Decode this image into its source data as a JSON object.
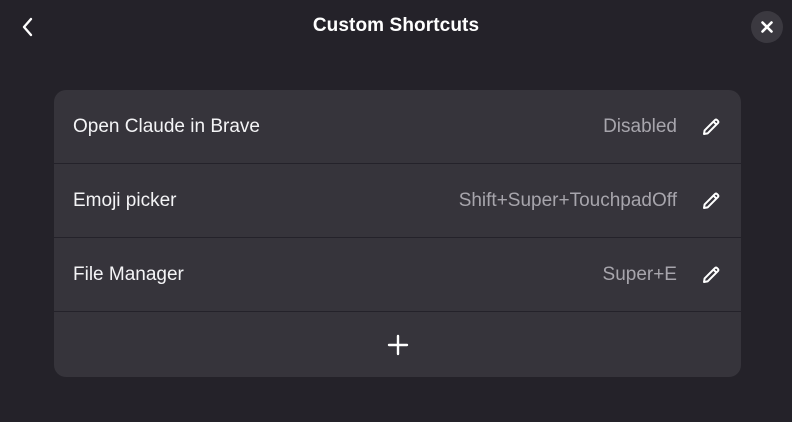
{
  "header": {
    "title": "Custom Shortcuts"
  },
  "shortcuts": [
    {
      "name": "Open Claude in Brave",
      "accel": "Disabled"
    },
    {
      "name": "Emoji picker",
      "accel": "Shift+Super+TouchpadOff"
    },
    {
      "name": "File Manager",
      "accel": "Super+E"
    }
  ],
  "icons": {
    "back": "chevron-left-icon",
    "close": "close-icon",
    "edit": "pencil-icon",
    "add": "plus-icon"
  },
  "colors": {
    "background": "#242229",
    "card": "#36343b",
    "secondary_text": "#a7a5ac",
    "close_button": "#3b3940"
  }
}
